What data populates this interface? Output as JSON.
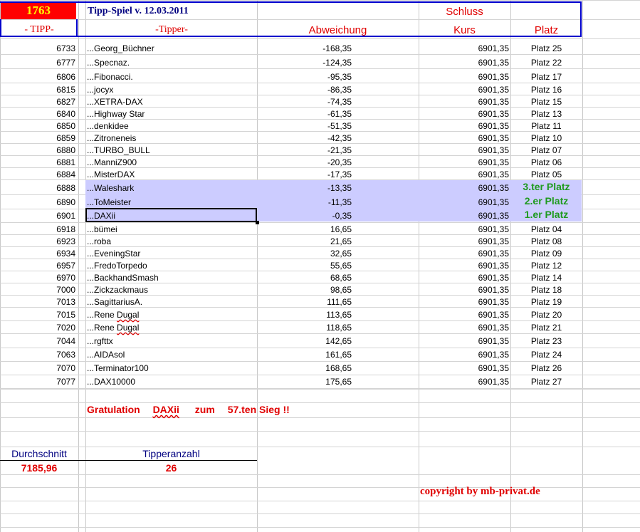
{
  "header": {
    "count": "1763",
    "game_title": "Tipp-Spiel v. 12.03.2011",
    "schluss": "Schluss",
    "col_tipp": "- TIPP-",
    "col_tipper": "-Tipper-",
    "col_abweichung": "Abweichung",
    "col_kurs": "Kurs",
    "col_platz": "Platz"
  },
  "rows": [
    {
      "tipp": "6733",
      "name": "...Georg_Büchner",
      "abw": "-168,35",
      "kurs": "6901,35",
      "platz": "Platz 25"
    },
    {
      "tipp": "6777",
      "name": "...Specnaz.",
      "abw": "-124,35",
      "kurs": "6901,35",
      "platz": "Platz 22"
    },
    {
      "tipp": "6806",
      "name": "...Fibonacci.",
      "abw": "-95,35",
      "kurs": "6901,35",
      "platz": "Platz 17"
    },
    {
      "tipp": "6815",
      "name": "...jocyx",
      "abw": "-86,35",
      "kurs": "6901,35",
      "platz": "Platz 16"
    },
    {
      "tipp": "6827",
      "name": "...XETRA-DAX",
      "abw": "-74,35",
      "kurs": "6901,35",
      "platz": "Platz 15"
    },
    {
      "tipp": "6840",
      "name": "...Highway Star",
      "abw": "-61,35",
      "kurs": "6901,35",
      "platz": "Platz 13"
    },
    {
      "tipp": "6850",
      "name": "...denkidee",
      "abw": "-51,35",
      "kurs": "6901,35",
      "platz": "Platz 11"
    },
    {
      "tipp": "6859",
      "name": "...Zitroneneis",
      "abw": "-42,35",
      "kurs": "6901,35",
      "platz": "Platz 10"
    },
    {
      "tipp": "6880",
      "name": "...TURBO_BULL",
      "abw": "-21,35",
      "kurs": "6901,35",
      "platz": "Platz 07"
    },
    {
      "tipp": "6881",
      "name": "...ManniZ900",
      "abw": "-20,35",
      "kurs": "6901,35",
      "platz": "Platz 06"
    },
    {
      "tipp": "6884",
      "name": "...MisterDAX",
      "abw": "-17,35",
      "kurs": "6901,35",
      "platz": "Platz 05"
    },
    {
      "tipp": "6888",
      "name": "...Waleshark",
      "abw": "-13,35",
      "kurs": "6901,35",
      "platz": "3.ter Platz"
    },
    {
      "tipp": "6890",
      "name": "...ToMeister",
      "abw": "-11,35",
      "kurs": "6901,35",
      "platz": "2.er Platz"
    },
    {
      "tipp": "6901",
      "name": "...DAXii",
      "abw": "-0,35",
      "kurs": "6901,35",
      "platz": "1.er Platz"
    },
    {
      "tipp": "6918",
      "name": "...bümei",
      "abw": "16,65",
      "kurs": "6901,35",
      "platz": "Platz 04"
    },
    {
      "tipp": "6923",
      "name": "...roba",
      "abw": "21,65",
      "kurs": "6901,35",
      "platz": "Platz 08"
    },
    {
      "tipp": "6934",
      "name": "...EveningStar",
      "abw": "32,65",
      "kurs": "6901,35",
      "platz": "Platz 09"
    },
    {
      "tipp": "6957",
      "name": "...FredoTorpedo",
      "abw": "55,65",
      "kurs": "6901,35",
      "platz": "Platz 12"
    },
    {
      "tipp": "6970",
      "name": "...BackhandSmash",
      "abw": "68,65",
      "kurs": "6901,35",
      "platz": "Platz 14"
    },
    {
      "tipp": "7000",
      "name": "...Zickzackmaus",
      "abw": "98,65",
      "kurs": "6901,35",
      "platz": "Platz 18"
    },
    {
      "tipp": "7013",
      "name": "...SagittariusA.",
      "abw": "111,65",
      "kurs": "6901,35",
      "platz": "Platz 19"
    },
    {
      "tipp": "7015",
      "name": "...Rene Dugal",
      "abw": "113,65",
      "kurs": "6901,35",
      "platz": "Platz 20"
    },
    {
      "tipp": "7020",
      "name": "...Rene Dugal",
      "abw": "118,65",
      "kurs": "6901,35",
      "platz": "Platz 21"
    },
    {
      "tipp": "7044",
      "name": "...rgfttx",
      "abw": "142,65",
      "kurs": "6901,35",
      "platz": "Platz 23"
    },
    {
      "tipp": "7063",
      "name": "...AIDAsol",
      "abw": "161,65",
      "kurs": "6901,35",
      "platz": "Platz 24"
    },
    {
      "tipp": "7070",
      "name": "...Terminator100",
      "abw": "168,65",
      "kurs": "6901,35",
      "platz": "Platz 26"
    },
    {
      "tipp": "7077",
      "name": "...DAX10000",
      "abw": "175,65",
      "kurs": "6901,35",
      "platz": "Platz 27"
    }
  ],
  "congrats": {
    "word1": "Gratulation",
    "winner": "DAXii",
    "word2": "zum",
    "wins": "57.ten Sieg !!"
  },
  "stats": {
    "avg_label": "Durchschnitt",
    "avg_value": "7185,96",
    "count_label": "Tipperanzahl",
    "count_value": "26"
  },
  "copyright": "copyright by mb-privat.de",
  "colors": {
    "header_red": "#ff0000",
    "header_yellow": "#ffff00",
    "title_blue": "#000080",
    "frame_blue": "#0000cc",
    "podium_bg": "#ccccff",
    "podium_green": "#1e9a1e"
  }
}
